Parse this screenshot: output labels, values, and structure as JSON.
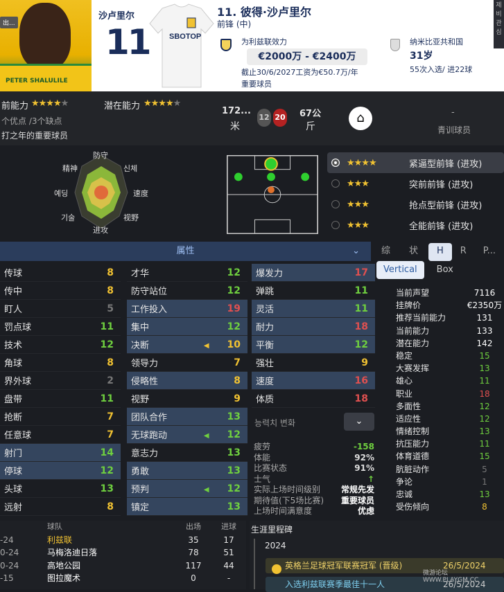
{
  "header": {
    "back_label": "出...",
    "photo_text": "PETER SHALULILE",
    "jersey_name": "沙卢里尔",
    "jersey_number": "11",
    "shirt_sponsor": "SBOTOP",
    "player_title": "11. 彼得·沙卢里尔",
    "position": "前锋 (中)",
    "club_line": "为利兹联效力",
    "value_range": "€2000万 - €2400万",
    "contract": "截止30/6/2027工资为€50.7万/年",
    "status": "重要球员",
    "nationality": "纳米比亚共和国",
    "age": "31岁",
    "caps": "55次入选/ 进22球",
    "side_buttons": [
      "제",
      "비",
      "관",
      "심"
    ]
  },
  "summary": {
    "ca_label": "前能力",
    "pa_label": "潜在能力",
    "ca_stars": 3.5,
    "pa_stars": 3.5,
    "traits": "个优点 /3个缺点",
    "desc": "打之年的重要球员",
    "height_value": "172...",
    "height_unit": "米",
    "foot_left": "12",
    "foot_right": "20",
    "weight_value": "67公",
    "weight_unit": "斤",
    "youth_value": "-",
    "youth_label": "青训球员"
  },
  "radar_labels": [
    "防守",
    "精神",
    "신체",
    "예딩",
    "速度",
    "기술",
    "视野",
    "进攻"
  ],
  "roles": [
    {
      "stars": 3.5,
      "name": "紧逼型前锋 (进攻)",
      "selected": true
    },
    {
      "stars": 3,
      "name": "突前前锋 (进攻)",
      "selected": false
    },
    {
      "stars": 3,
      "name": "抢点型前锋 (进攻)",
      "selected": false
    },
    {
      "stars": 3,
      "name": "全能前锋 (进攻)",
      "selected": false
    }
  ],
  "attributes_bar": "属性",
  "tabs": [
    "综合",
    "状态",
    "H",
    "R",
    "P..."
  ],
  "tab_active": "H",
  "col1": [
    {
      "name": "传球",
      "v": "8",
      "c": "#f1c232",
      "hl": false
    },
    {
      "name": "传中",
      "v": "8",
      "c": "#f1c232",
      "hl": false
    },
    {
      "name": "盯人",
      "v": "5",
      "c": "#777",
      "hl": false
    },
    {
      "name": "罚点球",
      "v": "11",
      "c": "#6fcf3f",
      "hl": false
    },
    {
      "name": "技术",
      "v": "12",
      "c": "#6fcf3f",
      "hl": false
    },
    {
      "name": "角球",
      "v": "8",
      "c": "#f1c232",
      "hl": false
    },
    {
      "name": "界外球",
      "v": "2",
      "c": "#777",
      "hl": false
    },
    {
      "name": "盘带",
      "v": "11",
      "c": "#6fcf3f",
      "hl": false
    },
    {
      "name": "抢断",
      "v": "7",
      "c": "#f1c232",
      "hl": false
    },
    {
      "name": "任意球",
      "v": "7",
      "c": "#f1c232",
      "hl": false
    },
    {
      "name": "射门",
      "v": "14",
      "c": "#6fcf3f",
      "hl": true
    },
    {
      "name": "停球",
      "v": "12",
      "c": "#6fcf3f",
      "hl": true
    },
    {
      "name": "头球",
      "v": "13",
      "c": "#6fcf3f",
      "hl": false
    },
    {
      "name": "远射",
      "v": "8",
      "c": "#f1c232",
      "hl": false
    }
  ],
  "col2": [
    {
      "name": "才华",
      "v": "12",
      "c": "#6fcf3f",
      "hl": false
    },
    {
      "name": "防守站位",
      "v": "12",
      "c": "#6fcf3f",
      "hl": false
    },
    {
      "name": "工作投入",
      "v": "19",
      "c": "#e05050",
      "hl": true
    },
    {
      "name": "集中",
      "v": "12",
      "c": "#6fcf3f",
      "hl": true
    },
    {
      "name": "决断",
      "v": "10",
      "c": "#f1c232",
      "hl": true,
      "arrow": true
    },
    {
      "name": "领导力",
      "v": "7",
      "c": "#f1c232",
      "hl": false
    },
    {
      "name": "侵略性",
      "v": "8",
      "c": "#f1c232",
      "hl": true
    },
    {
      "name": "视野",
      "v": "9",
      "c": "#f1c232",
      "hl": false
    },
    {
      "name": "团队合作",
      "v": "13",
      "c": "#6fcf3f",
      "hl": true
    },
    {
      "name": "无球跑动",
      "v": "12",
      "c": "#6fcf3f",
      "hl": true,
      "arrow": true
    },
    {
      "name": "意志力",
      "v": "13",
      "c": "#6fcf3f",
      "hl": false
    },
    {
      "name": "勇敢",
      "v": "13",
      "c": "#6fcf3f",
      "hl": true
    },
    {
      "name": "预判",
      "v": "12",
      "c": "#6fcf3f",
      "hl": true,
      "arrow": true
    },
    {
      "name": "镇定",
      "v": "13",
      "c": "#6fcf3f",
      "hl": true
    }
  ],
  "col3": [
    {
      "name": "爆发力",
      "v": "17",
      "c": "#e05050",
      "hl": true
    },
    {
      "name": "弹跳",
      "v": "11",
      "c": "#6fcf3f",
      "hl": false
    },
    {
      "name": "灵活",
      "v": "11",
      "c": "#6fcf3f",
      "hl": true
    },
    {
      "name": "耐力",
      "v": "18",
      "c": "#e05050",
      "hl": true
    },
    {
      "name": "平衡",
      "v": "12",
      "c": "#6fcf3f",
      "hl": true
    },
    {
      "name": "强壮",
      "v": "9",
      "c": "#f1c232",
      "hl": false
    },
    {
      "name": "速度",
      "v": "16",
      "c": "#e05050",
      "hl": true
    },
    {
      "name": "体质",
      "v": "18",
      "c": "#e05050",
      "hl": false
    }
  ],
  "change_label": "능력치 변화",
  "condition": [
    {
      "k": "疲劳",
      "v": "-158",
      "c": "#6fcf3f"
    },
    {
      "k": "体能",
      "v": "92%",
      "c": "#ddd"
    },
    {
      "k": "比赛状态",
      "v": "91%",
      "c": "#ddd"
    },
    {
      "k": "士气",
      "v": "↑",
      "c": "#6fcf3f"
    },
    {
      "k": "实际上场时间级别",
      "v": "常规先发",
      "c": "#fff"
    },
    {
      "k": "期待值(下5场比赛)",
      "v": "重要球员",
      "c": "#fff"
    },
    {
      "k": "上场时间满意度",
      "v": "优虑",
      "c": "#fff"
    }
  ],
  "view_tabs": [
    "Vertical",
    "Box"
  ],
  "info": [
    {
      "k": "当前声望",
      "v": "7116",
      "c": "#fff"
    },
    {
      "k": "挂牌价",
      "v": "€2350万",
      "c": "#fff"
    },
    {
      "k": "推荐当前能力",
      "v": "131",
      "c": "#fff"
    },
    {
      "k": "当前能力",
      "v": "133",
      "c": "#fff"
    },
    {
      "k": "潜在能力",
      "v": "142",
      "c": "#fff"
    },
    {
      "k": "稳定",
      "v": "15",
      "c": "#6fcf3f"
    },
    {
      "k": "大赛发挥",
      "v": "13",
      "c": "#6fcf3f"
    },
    {
      "k": "雄心",
      "v": "11",
      "c": "#6fcf3f"
    },
    {
      "k": "职业",
      "v": "18",
      "c": "#e05050"
    },
    {
      "k": "多面性",
      "v": "12",
      "c": "#6fcf3f"
    },
    {
      "k": "适应性",
      "v": "12",
      "c": "#6fcf3f"
    },
    {
      "k": "情绪控制",
      "v": "13",
      "c": "#6fcf3f"
    },
    {
      "k": "抗压能力",
      "v": "11",
      "c": "#6fcf3f"
    },
    {
      "k": "体育道德",
      "v": "15",
      "c": "#6fcf3f"
    },
    {
      "k": "肮脏动作",
      "v": "5",
      "c": "#777"
    },
    {
      "k": "争论",
      "v": "1",
      "c": "#777"
    },
    {
      "k": "忠诚",
      "v": "13",
      "c": "#6fcf3f"
    },
    {
      "k": "受伤倾向",
      "v": "8",
      "c": "#f1c232"
    }
  ],
  "history": {
    "headers": [
      "球队",
      "出场",
      "进球"
    ],
    "rows": [
      {
        "y": "-24",
        "team": "利兹联",
        "apps": "35",
        "goals": "17",
        "c": "#f1c232"
      },
      {
        "y": "0-24",
        "team": "马梅洛迪日落",
        "apps": "78",
        "goals": "51",
        "c": "#fff"
      },
      {
        "y": "0-24",
        "team": "高地公园",
        "apps": "117",
        "goals": "44",
        "c": "#fff"
      },
      {
        "y": "-15",
        "team": "图拉魔术",
        "apps": "0",
        "goals": "-",
        "c": "#fff"
      }
    ]
  },
  "career": {
    "title": "生涯里程碑",
    "year": "2024",
    "events": [
      {
        "t": "英格兰足球冠军联赛冠军 (晋级)",
        "d": "26/5/2024"
      },
      {
        "t": "入选利兹联赛季最佳十一人",
        "d": "26/5/2024"
      }
    ]
  },
  "watermark": "微游论坛 WWW.PLAYGM.CC"
}
